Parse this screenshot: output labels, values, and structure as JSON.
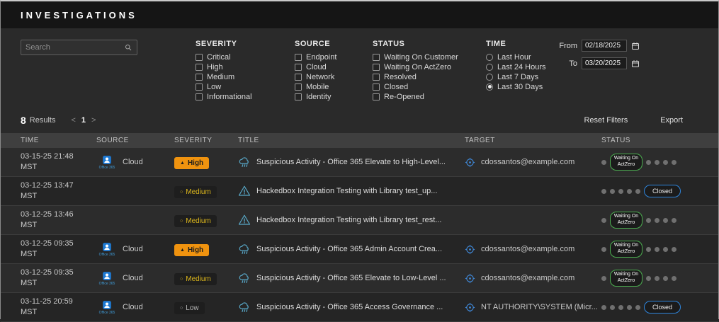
{
  "header": {
    "title": "INVESTIGATIONS"
  },
  "filters": {
    "search": {
      "placeholder": "Search"
    },
    "severity": {
      "label": "SEVERITY",
      "options": [
        "Critical",
        "High",
        "Medium",
        "Low",
        "Informational"
      ]
    },
    "source": {
      "label": "SOURCE",
      "options": [
        "Endpoint",
        "Cloud",
        "Network",
        "Mobile",
        "Identity"
      ]
    },
    "status": {
      "label": "STATUS",
      "options": [
        "Waiting On Customer",
        "Waiting On ActZero",
        "Resolved",
        "Closed",
        "Re-Opened"
      ]
    },
    "time": {
      "label": "TIME",
      "options": [
        "Last Hour",
        "Last 24 Hours",
        "Last 7 Days",
        "Last 30 Days"
      ],
      "selected": "Last 30 Days"
    },
    "range": {
      "from_label": "From",
      "from_value": "02/18/2025",
      "to_label": "To",
      "to_value": "03/20/2025"
    }
  },
  "results": {
    "count": "8",
    "label": "Results",
    "prev": "<",
    "page": "1",
    "next": ">",
    "reset": "Reset Filters",
    "export": "Export"
  },
  "table": {
    "headers": {
      "time": "TIME",
      "source": "SOURCE",
      "severity": "SEVERITY",
      "title": "TITLE",
      "target": "TARGET",
      "status": "STATUS"
    },
    "rows": [
      {
        "time1": "03-15-25 21:48",
        "time2": "MST",
        "source_icon_caption": "Office 365",
        "source_label": "Cloud",
        "severity": "High",
        "title": "Suspicious Activity - Office 365 Elevate to High-Level...",
        "target": "cdossantos@example.com",
        "status": "Waiting On ActZero"
      },
      {
        "time1": "03-12-25 13:47",
        "time2": "MST",
        "severity": "Medium",
        "title": "Hackedbox Integration Testing with Library test_up...",
        "status": "Closed"
      },
      {
        "time1": "03-12-25 13:46",
        "time2": "MST",
        "severity": "Medium",
        "title": "Hackedbox Integration Testing with Library test_rest...",
        "status": "Waiting On ActZero"
      },
      {
        "time1": "03-12-25 09:35",
        "time2": "MST",
        "source_icon_caption": "Office 365",
        "source_label": "Cloud",
        "severity": "High",
        "title": "Suspicious Activity - Office 365 Admin Account Crea...",
        "target": "cdossantos@example.com",
        "status": "Waiting On ActZero"
      },
      {
        "time1": "03-12-25 09:35",
        "time2": "MST",
        "source_icon_caption": "Office 365",
        "source_label": "Cloud",
        "severity": "Medium",
        "title": "Suspicious Activity - Office 365 Elevate to Low-Level ...",
        "target": "cdossantos@example.com",
        "status": "Waiting On ActZero"
      },
      {
        "time1": "03-11-25 20:59",
        "time2": "MST",
        "source_icon_caption": "Office 365",
        "source_label": "Cloud",
        "severity": "Low",
        "title": "Suspicious Activity - Office 365 Access Governance ...",
        "target": "NT AUTHORITY\\SYSTEM (Micr...",
        "status": "Closed"
      }
    ]
  },
  "colors": {
    "severity_high_bg": "#f0930f",
    "severity_medium_text": "#d9b41c",
    "status_waiting_border": "#4caf50",
    "status_closed_border": "#2e86de",
    "alert_icon": "#58a8c8",
    "target_icon": "#3f87d6",
    "office365_blue": "#1e7ad4"
  }
}
